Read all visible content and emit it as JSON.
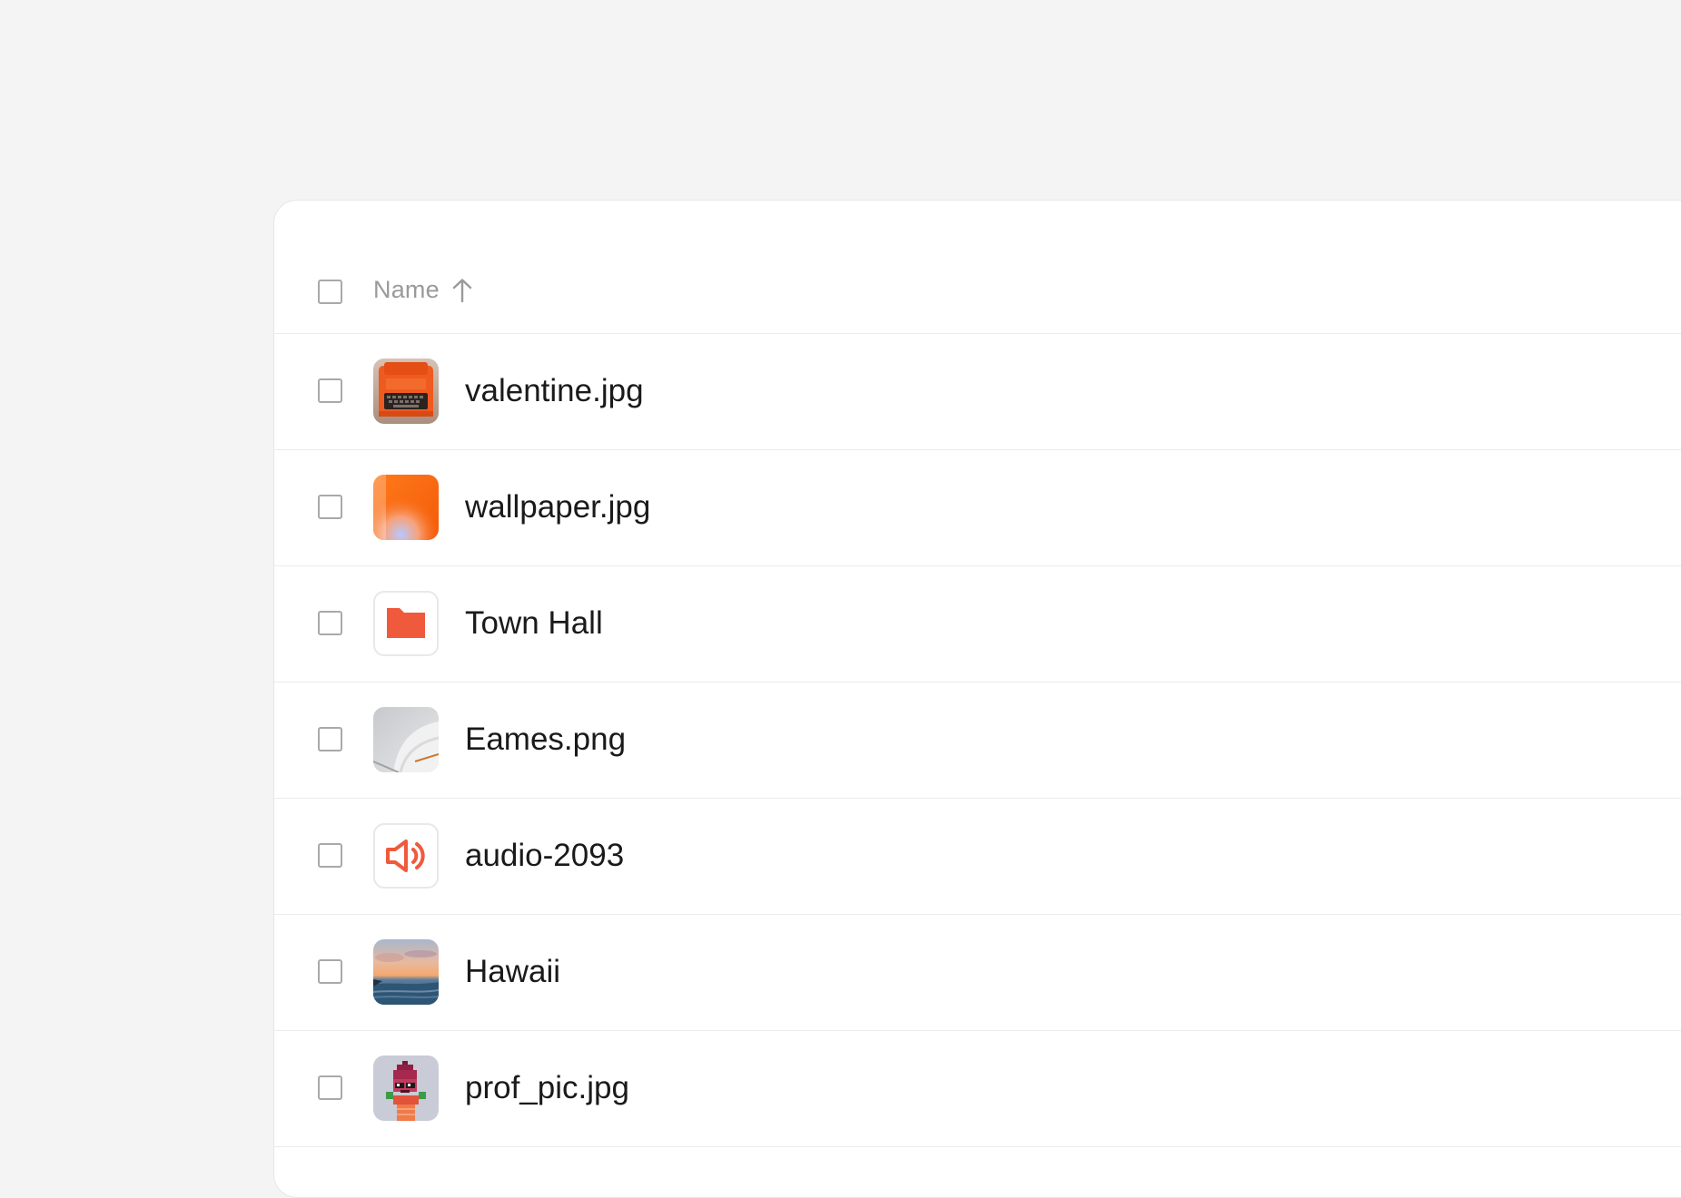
{
  "header": {
    "column_name": "Name",
    "sort_direction": "ascending",
    "sort_icon": "arrow-up-icon"
  },
  "colors": {
    "accent": "#f05a3c",
    "page_background": "#f4f4f4",
    "panel_background": "#ffffff",
    "divider": "#ececec",
    "text": "#1a1a1a",
    "header_text": "#9a9a9a"
  },
  "files": [
    {
      "name": "valentine.jpg",
      "thumbnail": "orange-typewriter-photo"
    },
    {
      "name": "wallpaper.jpg",
      "thumbnail": "orange-gradient-image"
    },
    {
      "name": "Town Hall",
      "thumbnail": "folder-icon"
    },
    {
      "name": "Eames.png",
      "thumbnail": "gray-chair-photo"
    },
    {
      "name": "audio-2093",
      "thumbnail": "speaker-icon"
    },
    {
      "name": "Hawaii",
      "thumbnail": "sunset-ocean-photo"
    },
    {
      "name": "prof_pic.jpg",
      "thumbnail": "pixel-avatar-image"
    }
  ]
}
